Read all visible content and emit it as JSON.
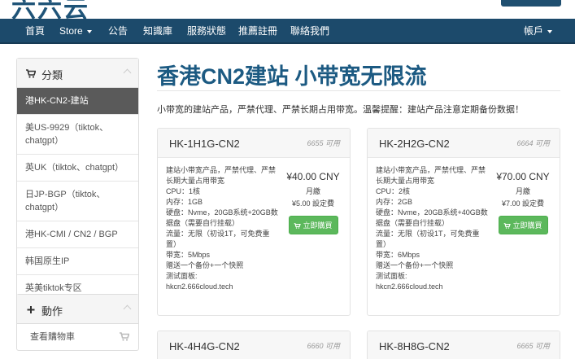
{
  "header": {
    "logo": "六六云"
  },
  "navbar": {
    "items": [
      {
        "label": "首頁"
      },
      {
        "label": "Store",
        "dropdown": true
      },
      {
        "label": "公告"
      },
      {
        "label": "知識庫"
      },
      {
        "label": "服務狀態"
      },
      {
        "label": "推薦註冊"
      },
      {
        "label": "聯絡我們"
      }
    ],
    "account": {
      "label": "帳戶",
      "dropdown": true
    }
  },
  "sidebar": {
    "categories": {
      "title": "分類",
      "icon": "cart-icon",
      "items": [
        {
          "label": "港HK-CN2-建站",
          "active": true
        },
        {
          "label": "美US-9929（tiktok、chatgpt）"
        },
        {
          "label": "英UK（tiktok、chatgpt）"
        },
        {
          "label": "日JP-BGP（tiktok、chatgpt）"
        },
        {
          "label": "港HK-CMI / CN2 / BGP"
        },
        {
          "label": "韩国原生IP"
        },
        {
          "label": "英美tiktok专区"
        }
      ]
    },
    "actions": {
      "title": "動作",
      "icon": "plus-icon",
      "items": [
        {
          "label": "查看購物車",
          "icon": "cart-icon"
        }
      ]
    }
  },
  "main": {
    "title": "香港CN2建站 小带宽无限流",
    "intro": "小带宽的建站产品，严禁代理、严禁长期占用带宽。温馨提醒：建站产品注意定期备份数据！",
    "products": [
      {
        "name": "HK-1H1G-CN2",
        "available": "6655 可用",
        "description": [
          "建站小带宽产品，严禁代理、严禁长期大量占用带宽",
          "CPU：1核",
          "内存：1GB",
          "硬盘：Nvme，20GB系统+20GB数据盘（需要自行挂载）",
          "流量：无限（初设1T，可免费重置）",
          "带宽：5Mbps",
          "赠送一个备份+一个快照",
          "测试面板:",
          "hkcn2.666cloud.tech"
        ],
        "price": "¥40.00 CNY",
        "cycle": "月繳",
        "setup_fee": "¥5.00 設定費",
        "order_label": "立即購買"
      },
      {
        "name": "HK-2H2G-CN2",
        "available": "6664 可用",
        "description": [
          "建站小带宽产品，严禁代理、严禁长期大量占用带宽",
          "CPU：2核",
          "内存：2GB",
          "硬盘：Nvme，20GB系统+40GB数据盘（需要自行挂载）",
          "流量：无限（初设1T，可免费重置）",
          "带宽：6Mbps",
          "赠送一个备份+一个快照",
          "测试面板:",
          "hkcn2.666cloud.tech"
        ],
        "price": "¥70.00 CNY",
        "cycle": "月繳",
        "setup_fee": "¥7.00 設定費",
        "order_label": "立即購買"
      },
      {
        "name": "HK-4H4G-CN2",
        "available": "6660 可用"
      },
      {
        "name": "HK-8H8G-CN2",
        "available": "6665 可用"
      }
    ]
  },
  "colors": {
    "navbar": "#1c4a6b",
    "title": "#1c5a82",
    "order_button": "#5cb85c",
    "sidebar_active": "#5a5a5a"
  }
}
